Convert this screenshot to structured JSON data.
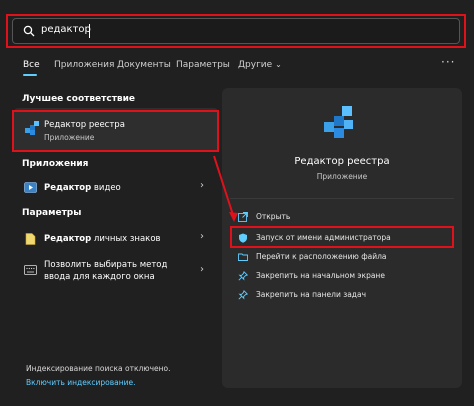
{
  "search": {
    "value": "редактор"
  },
  "tabs": [
    "Все",
    "Приложения",
    "Документы",
    "Параметры",
    "Другие"
  ],
  "sections": {
    "best_match": "Лучшее соответствие",
    "apps": "Приложения",
    "settings": "Параметры"
  },
  "best_match": {
    "title": "Редактор реестра",
    "subtitle": "Приложение"
  },
  "apps": [
    {
      "title_bold": "Редактор",
      "title_rest": " видео"
    }
  ],
  "settings": [
    {
      "title_bold": "Редактор",
      "title_rest": " личных знаков"
    },
    {
      "line1": "Позволить выбирать метод",
      "line2": "ввода для каждого окна"
    }
  ],
  "detail": {
    "title": "Редактор реестра",
    "subtitle": "Приложение"
  },
  "actions": [
    {
      "label": "Открыть",
      "icon": "open-icon"
    },
    {
      "label": "Запуск от имени администратора",
      "icon": "shield-icon"
    },
    {
      "label": "Перейти к расположению файла",
      "icon": "folder-icon"
    },
    {
      "label": "Закрепить на начальном экране",
      "icon": "pin-icon"
    },
    {
      "label": "Закрепить на панели задач",
      "icon": "pin-icon"
    }
  ],
  "footer": {
    "status": "Индексирование поиска отключено.",
    "link": "Включить индексирование."
  },
  "colors": {
    "accent": "#60cdff",
    "highlight": "#e0111b",
    "link": "#60cdff"
  }
}
